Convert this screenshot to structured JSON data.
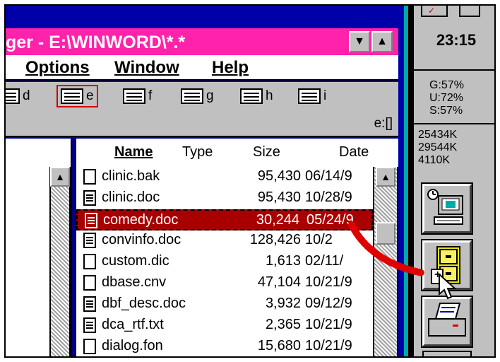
{
  "window": {
    "title": "ger - E:\\WINWORD\\*.*",
    "minimize_glyph": "▼",
    "maximize_glyph": "▲"
  },
  "menu": {
    "options": "Options",
    "window": "Window",
    "help": "Help"
  },
  "drives": [
    {
      "letter": "d"
    },
    {
      "letter": "e",
      "selected": true
    },
    {
      "letter": "f"
    },
    {
      "letter": "g"
    },
    {
      "letter": "h"
    },
    {
      "letter": "i"
    }
  ],
  "drive_path": "e:[]",
  "list": {
    "headers": {
      "name": "Name",
      "type": "Type",
      "size": "Size",
      "date": "Date"
    },
    "rows": [
      {
        "name": "clinic.bak",
        "size": "95,430",
        "date": "06/14/9",
        "icon": "blank-file-icon"
      },
      {
        "name": "clinic.doc",
        "size": "95,430",
        "date": "10/28/9",
        "icon": "document-file-icon"
      },
      {
        "name": "comedy.doc",
        "size": "30,244",
        "date": "05/24/9",
        "icon": "document-file-icon",
        "selected": true
      },
      {
        "name": "convinfo.doc",
        "size": "128,426",
        "date": "10/2",
        "icon": "document-file-icon"
      },
      {
        "name": "custom.dic",
        "size": "1,613",
        "date": "02/11/",
        "icon": "blank-file-icon"
      },
      {
        "name": "dbase.cnv",
        "size": "47,104",
        "date": "10/21/9",
        "icon": "blank-file-icon"
      },
      {
        "name": "dbf_desc.doc",
        "size": "3,932",
        "date": "09/12/9",
        "icon": "document-file-icon"
      },
      {
        "name": "dca_rtf.txt",
        "size": "2,365",
        "date": "10/21/9",
        "icon": "document-file-icon"
      },
      {
        "name": "dialog.fon",
        "size": "15,680",
        "date": "10/21/9",
        "icon": "blank-file-icon"
      }
    ]
  },
  "sidebar": {
    "clock": "23:15",
    "g": "G:57%",
    "u": "U:72%",
    "s": "S:57%",
    "mem1": "25434K",
    "mem2": "29544K",
    "mem3": "4110K"
  },
  "colors": {
    "titlebar": "#ff22aa",
    "selection": "#a80000",
    "desktop": "#00a8a8",
    "drag_arrow": "#e00000"
  }
}
